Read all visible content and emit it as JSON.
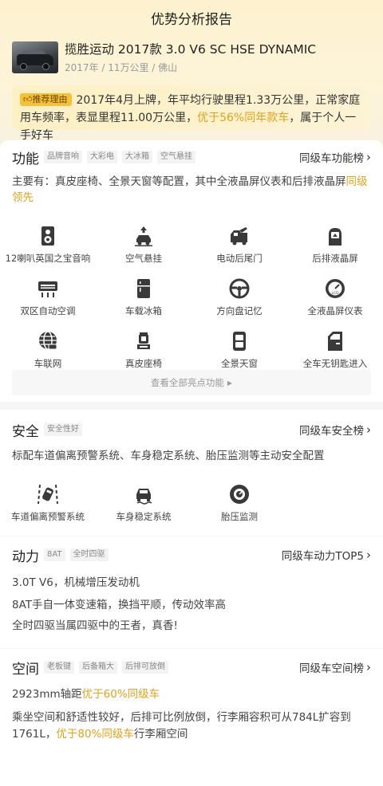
{
  "page": {
    "title": "优势分析报告"
  },
  "car": {
    "name": "揽胜运动 2017款 3.0 V6 SC HSE DYNAMIC",
    "meta": "2017年 / 11万公里 / 佛山"
  },
  "recommend": {
    "badge": "推荐理由",
    "text_a": "2017年4月上牌，年平均行驶里程1.33万公里，正常家庭用车频率，表显里程11.00万公里，",
    "highlight": "优于56%同年款车",
    "text_b": "，属于个人一手好车"
  },
  "function": {
    "title": "功能",
    "tags": [
      "品牌音响",
      "大彩电",
      "大冰箱",
      "空气悬挂"
    ],
    "rank": "同级车功能榜",
    "desc_a": "主要有：真皮座椅、全景天窗等配置，其中全液晶屏仪表和后排液晶屏",
    "desc_hl": "同级领先",
    "items": [
      {
        "label": "12喇叭英国之宝音响",
        "icon": "speaker-icon"
      },
      {
        "label": "空气悬挂",
        "icon": "air-suspension-icon"
      },
      {
        "label": "电动后尾门",
        "icon": "power-tailgate-icon"
      },
      {
        "label": "后排液晶屏",
        "icon": "rear-screen-icon"
      },
      {
        "label": "双区自动空调",
        "icon": "dual-zone-ac-icon"
      },
      {
        "label": "车载冰箱",
        "icon": "fridge-icon"
      },
      {
        "label": "方向盘记忆",
        "icon": "steering-wheel-icon"
      },
      {
        "label": "全液晶屏仪表",
        "icon": "lcd-gauge-icon"
      },
      {
        "label": "车联网",
        "icon": "car-network-icon"
      },
      {
        "label": "真皮座椅",
        "icon": "leather-seat-icon"
      },
      {
        "label": "全景天窗",
        "icon": "panoramic-sunroof-icon"
      },
      {
        "label": "全车无钥匙进入",
        "icon": "keyless-entry-icon"
      }
    ],
    "more": "查看全部亮点功能"
  },
  "safety": {
    "title": "安全",
    "tags": [
      "安全性好"
    ],
    "rank": "同级车安全榜",
    "desc": "标配车道偏离预警系统、车身稳定系统、胎压监测等主动安全配置",
    "items": [
      {
        "label": "车道偏离预警系统",
        "icon": "lane-departure-icon"
      },
      {
        "label": "车身稳定系统",
        "icon": "stability-icon"
      },
      {
        "label": "胎压监测",
        "icon": "tire-pressure-icon"
      }
    ]
  },
  "power": {
    "title": "动力",
    "tags": [
      "8AT",
      "全时四驱"
    ],
    "rank": "同级车动力TOP5",
    "lines": [
      "3.0T V6，机械增压发动机",
      "8AT手自一体变速箱，换挡平顺，传动效率高",
      "全时四驱当属四驱中的王者，真香!"
    ]
  },
  "space": {
    "title": "空间",
    "tags": [
      "老板键",
      "后备箱大",
      "后排可放倒"
    ],
    "rank": "同级车空间榜",
    "l1_a": "2923mm轴距",
    "l1_hl": "优于60%同级车",
    "l2_a": "乘坐空间和舒适性较好，后排可比例放倒，行李厢容积可从784L扩容到1761L，",
    "l2_hl": "优于80%同级车",
    "l2_b": "行李厢空间"
  },
  "colors": {
    "accent": "#e0a11b",
    "badge": "#f5c13a",
    "icon": "#3a3a3a"
  }
}
